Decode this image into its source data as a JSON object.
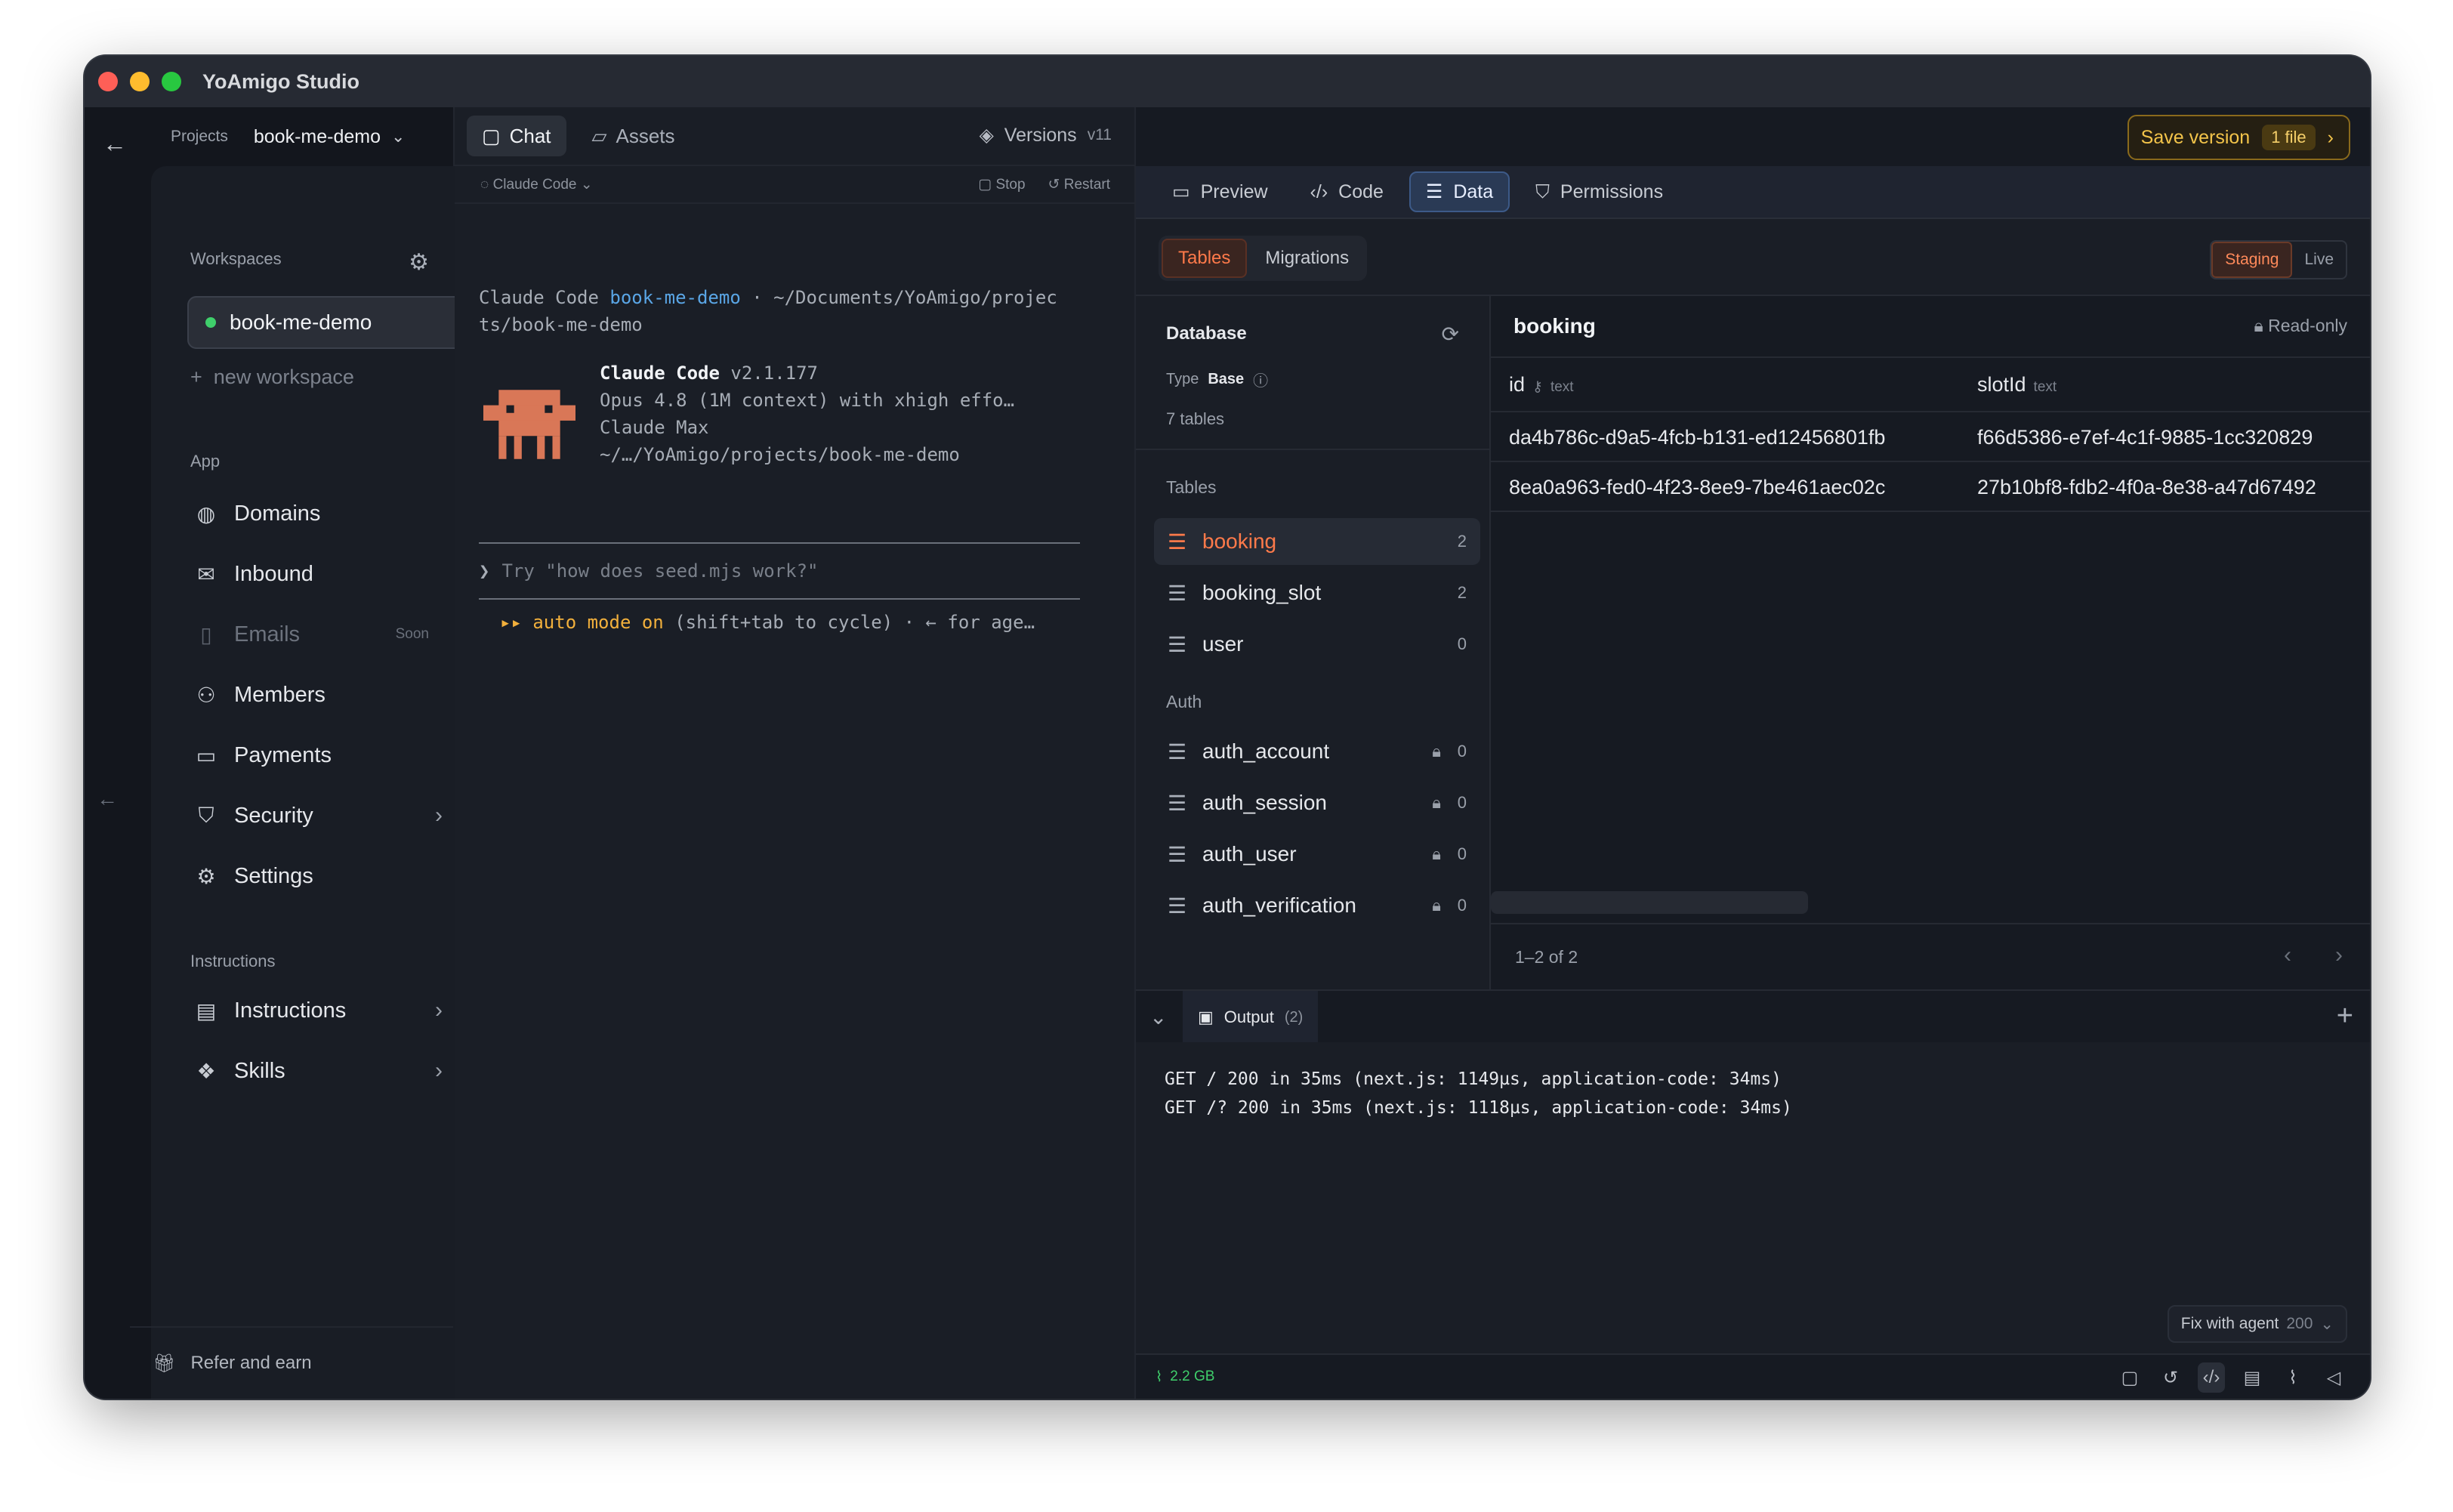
{
  "window": {
    "title": "YoAmigo Studio"
  },
  "project": {
    "label": "Projects",
    "name": "book-me-demo"
  },
  "sidebar": {
    "workspaces_label": "Workspaces",
    "active_workspace": "book-me-demo",
    "new_workspace": "new workspace",
    "app_label": "App",
    "items": [
      {
        "label": "Domains",
        "icon": "globe-icon"
      },
      {
        "label": "Inbound",
        "icon": "inbox-icon"
      },
      {
        "label": "Emails",
        "icon": "file-icon",
        "badge": "Soon"
      },
      {
        "label": "Members",
        "icon": "users-icon"
      },
      {
        "label": "Payments",
        "icon": "credit-card-icon"
      },
      {
        "label": "Security",
        "icon": "shield-icon"
      },
      {
        "label": "Settings",
        "icon": "gear-icon"
      }
    ],
    "instructions_label": "Instructions",
    "instr_items": [
      {
        "label": "Instructions",
        "icon": "document-icon"
      },
      {
        "label": "Skills",
        "icon": "skills-icon"
      }
    ],
    "refer": "Refer and earn"
  },
  "chat": {
    "tabs": [
      {
        "label": "Chat"
      },
      {
        "label": "Assets"
      }
    ],
    "versions": {
      "label": "Versions",
      "value": "v11"
    },
    "agent": "Claude Code",
    "stop": "Stop",
    "restart": "Restart",
    "path_prefix": "Claude Code ",
    "path_link": "book-me-demo",
    "path_rest": " · ~/Documents/YoAmigo/projec",
    "path_rest2": "ts/book-me-demo",
    "banner_title": "Claude Code",
    "banner_version": " v2.1.177",
    "banner_line2": "Opus 4.8 (1M context) with xhigh effo…",
    "banner_line3": "Claude Max",
    "banner_line4": "~/…/YoAmigo/projects/book-me-demo",
    "prompt_caret": "❯",
    "prompt_placeholder": "Try \"how does seed.mjs work?\"",
    "auto_arrows": "▸▸",
    "auto_mode": "auto mode on",
    "auto_rest": " (shift+tab to cycle) · ← for age…"
  },
  "toolbar": {
    "save_label": "Save version",
    "save_badge": "1 file",
    "tabs": [
      {
        "label": "Preview"
      },
      {
        "label": "Code"
      },
      {
        "label": "Data"
      },
      {
        "label": "Permissions"
      }
    ]
  },
  "data": {
    "seg": [
      "Tables",
      "Migrations"
    ],
    "env": [
      "Staging",
      "Live"
    ],
    "db_title": "Database",
    "type_label": "Type",
    "type_value": "Base",
    "table_count": "7 tables",
    "tables_label": "Tables",
    "tables": [
      {
        "name": "booking",
        "count": "2"
      },
      {
        "name": "booking_slot",
        "count": "2"
      },
      {
        "name": "user",
        "count": "0"
      }
    ],
    "auth_label": "Auth",
    "auth_tables": [
      {
        "name": "auth_account",
        "count": "0"
      },
      {
        "name": "auth_session",
        "count": "0"
      },
      {
        "name": "auth_user",
        "count": "0"
      },
      {
        "name": "auth_verification",
        "count": "0"
      }
    ],
    "grid_title": "booking",
    "readonly": "Read-only",
    "columns": [
      {
        "name": "id",
        "type": "text"
      },
      {
        "name": "slotId",
        "type": "text"
      }
    ],
    "rows": [
      [
        "da4b786c-d9a5-4fcb-b131-ed12456801fb",
        "f66d5386-e7ef-4c1f-9885-1cc320829"
      ],
      [
        "8ea0a963-fed0-4f23-8ee9-7be461aec02c",
        "27b10bf8-fdb2-4f0a-8e38-a47d67492"
      ]
    ],
    "pager": "1–2 of 2"
  },
  "output": {
    "tab_label": "Output",
    "tab_count": "(2)",
    "log1": "GET / 200 in 35ms (next.js: 1149µs, application-code: 34ms)",
    "log2": "GET /? 200 in 35ms (next.js: 1118µs, application-code: 34ms)",
    "fix_label": "Fix with agent",
    "fix_count": "200",
    "memory": "2.2 GB"
  },
  "colors": {
    "accent": "#ff7a4a",
    "save": "#f3c44a",
    "online": "#3fcf6b"
  }
}
